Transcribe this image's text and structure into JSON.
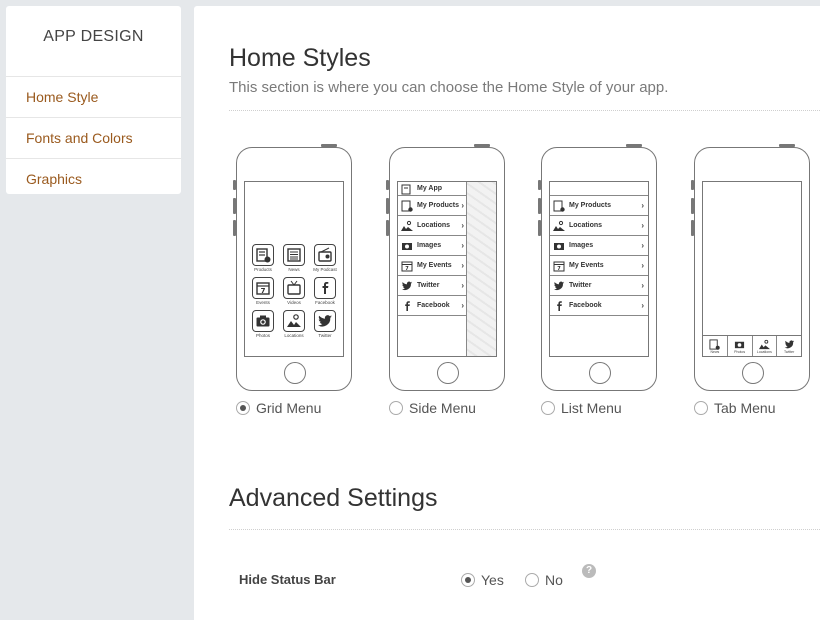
{
  "sidebar": {
    "title": "APP DESIGN",
    "items": [
      {
        "label": "Home Style"
      },
      {
        "label": "Fonts and Colors"
      },
      {
        "label": "Graphics"
      }
    ]
  },
  "home_styles": {
    "title": "Home Styles",
    "subtitle": "This section is where you can choose the Home Style of your app.",
    "options": [
      {
        "label": "Grid Menu",
        "selected": true
      },
      {
        "label": "Side Menu",
        "selected": false
      },
      {
        "label": "List Menu",
        "selected": false
      },
      {
        "label": "Tab Menu",
        "selected": false
      }
    ],
    "grid_labels": [
      "Products",
      "News",
      "My Podcast",
      "Events",
      "Videos",
      "Facebook",
      "Photos",
      "Locations",
      "Twitter"
    ],
    "side_menu": {
      "header": "My App",
      "items": [
        "My Products",
        "Locations",
        "Images",
        "My Events",
        "Twitter",
        "Facebook"
      ]
    },
    "list_menu": {
      "items": [
        "My Products",
        "Locations",
        "Images",
        "My Events",
        "Twitter",
        "Facebook"
      ]
    },
    "tab_labels": [
      "News",
      "Photos",
      "Locations",
      "Twitter"
    ],
    "calendar_day": "7"
  },
  "advanced": {
    "title": "Advanced Settings",
    "hide_status_bar": {
      "label": "Hide Status Bar",
      "yes": "Yes",
      "no": "No",
      "value": "Yes",
      "help": "?"
    }
  }
}
